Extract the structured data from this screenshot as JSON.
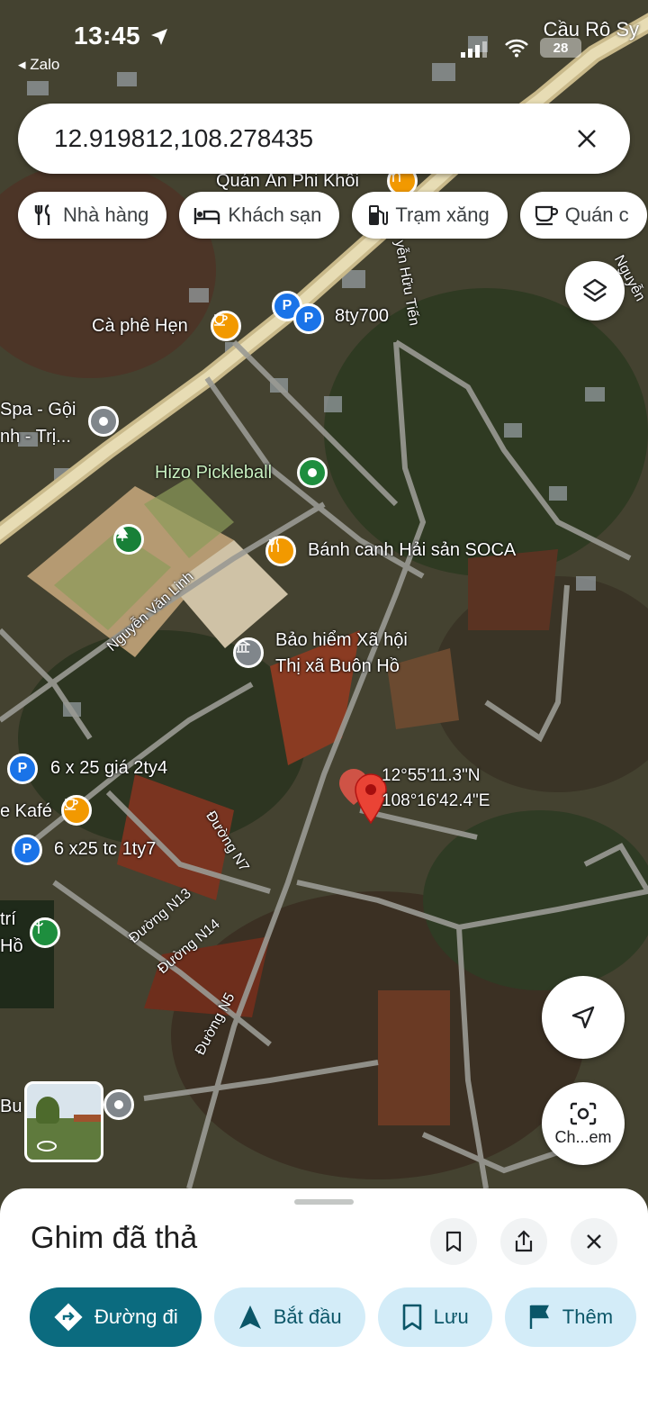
{
  "status": {
    "time": "13:45",
    "back_app": "◂ Zalo",
    "location_label": "Cầu Rô Sy",
    "battery": "28"
  },
  "search": {
    "value": "12.919812,108.278435"
  },
  "chips": [
    {
      "label": "Nhà hàng",
      "icon": "restaurant-icon"
    },
    {
      "label": "Khách sạn",
      "icon": "hotel-icon"
    },
    {
      "label": "Trạm xăng",
      "icon": "gas-station-icon"
    },
    {
      "label": "Quán c",
      "icon": "cafe-icon"
    }
  ],
  "places": {
    "quan_an": "Quán Ăn Phi Khôi",
    "ca_phe_hen": "Cà phê Hẹn",
    "p_8ty700": "8ty700",
    "spa": "Spa - Gội",
    "spa2": "nh -  Trị...",
    "hizo": "Hizo Pickleball",
    "banh_canh": "Bánh canh Hải sản SOCA",
    "bao_hiem1": "Bảo hiểm Xã hội",
    "bao_hiem2": "Thị xã Buôn Hồ",
    "lot1": "6 x 25 giá 2ty4",
    "kafe": "e Kafé",
    "lot2": "6 x25 tc 1ty7",
    "tri": "trí",
    "ho": "Hồ",
    "buc": "Bu"
  },
  "roads": {
    "nguyen_van_linh": "Nguyễn Văn Linh",
    "nguyen_huu_tien": "yễn Hữu Tiến",
    "nguyen_right": "Nguyễn",
    "n7": "Đường N7",
    "n13": "Đường N13",
    "n14": "Đường N14",
    "n5": "Đường N5"
  },
  "dropped_pin": {
    "lat": "12°55'11.3\"N",
    "lng": "108°16'42.4\"E"
  },
  "camera_button_label": "Ch...em",
  "sheet": {
    "title": "Ghim đã thả",
    "actions": [
      {
        "label": "Đường đi",
        "icon": "directions-icon"
      },
      {
        "label": "Bắt đầu",
        "icon": "navigation-arrow-icon"
      },
      {
        "label": "Lưu",
        "icon": "bookmark-icon"
      },
      {
        "label": "Thêm",
        "icon": "flag-icon"
      }
    ]
  },
  "colors": {
    "accent": "#0b6b7f",
    "chip_bg": "#d3ecf8",
    "pin_red": "#ea4335",
    "poi_orange": "#f29900",
    "poi_blue": "#1a73e8"
  }
}
